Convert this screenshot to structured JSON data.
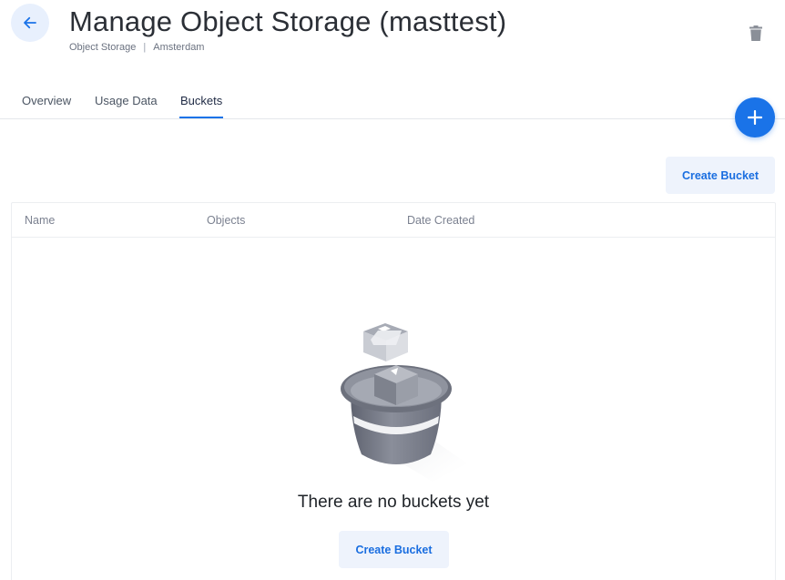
{
  "header": {
    "title": "Manage Object Storage (masttest)",
    "breadcrumb": {
      "service": "Object Storage",
      "separator": "|",
      "region": "Amsterdam"
    },
    "back_icon": "arrow-left-icon",
    "delete_icon": "trash-icon"
  },
  "tabs": [
    {
      "label": "Overview",
      "active": false
    },
    {
      "label": "Usage Data",
      "active": false
    },
    {
      "label": "Buckets",
      "active": true
    }
  ],
  "fab": {
    "icon": "plus-icon"
  },
  "toolbar": {
    "create_label": "Create Bucket"
  },
  "table": {
    "columns": [
      "Name",
      "Objects",
      "Date Created"
    ],
    "rows": []
  },
  "empty_state": {
    "illustration": "bucket-illustration",
    "message": "There are no buckets yet",
    "create_label": "Create Bucket"
  },
  "colors": {
    "accent": "#1a73e8",
    "button_bg": "#eef3fc",
    "button_text": "#1a6ee0"
  }
}
